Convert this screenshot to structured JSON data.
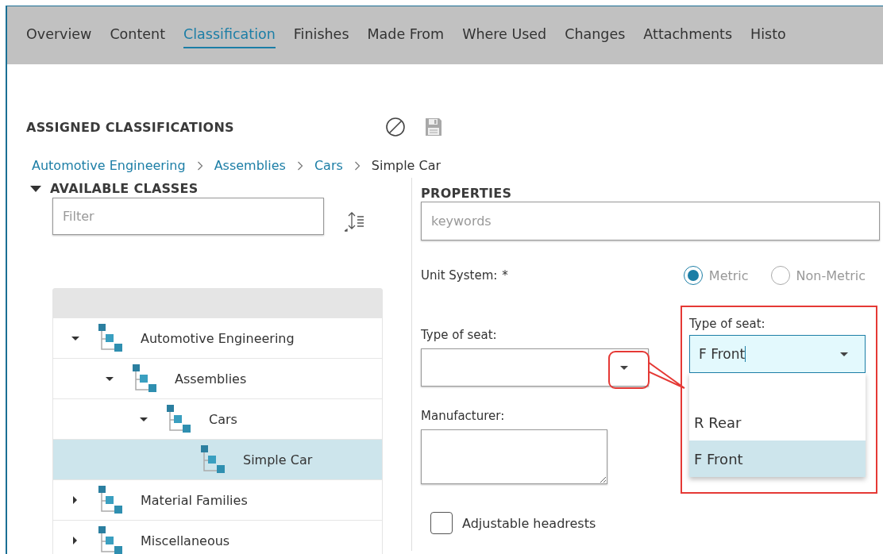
{
  "tabs": [
    {
      "label": "Overview",
      "selected": false
    },
    {
      "label": "Content",
      "selected": false
    },
    {
      "label": "Classification",
      "selected": true
    },
    {
      "label": "Finishes",
      "selected": false
    },
    {
      "label": "Made From",
      "selected": false
    },
    {
      "label": "Where Used",
      "selected": false
    },
    {
      "label": "Changes",
      "selected": false
    },
    {
      "label": "Attachments",
      "selected": false
    },
    {
      "label": "Histo",
      "selected": false
    }
  ],
  "assigned": {
    "title": "ASSIGNED CLASSIFICATIONS"
  },
  "breadcrumbs": [
    {
      "label": "Automotive Engineering",
      "kind": "link"
    },
    {
      "label": "Assemblies",
      "kind": "link"
    },
    {
      "label": "Cars",
      "kind": "link"
    },
    {
      "label": "Simple Car",
      "kind": "current"
    }
  ],
  "available_classes": {
    "title": "AVAILABLE CLASSES",
    "expanded": true,
    "filter": {
      "placeholder": "Filter"
    },
    "tree": [
      {
        "label": "Automotive Engineering",
        "expanded": true,
        "selected": false,
        "children": [
          {
            "label": "Assemblies",
            "expanded": true,
            "selected": false,
            "children": [
              {
                "label": "Cars",
                "expanded": true,
                "selected": false,
                "children": [
                  {
                    "label": "Simple Car",
                    "selected": true
                  }
                ]
              }
            ]
          }
        ]
      },
      {
        "label": "Material Families",
        "expanded": false,
        "selected": false
      },
      {
        "label": "Miscellaneous",
        "expanded": false,
        "selected": false
      }
    ]
  },
  "properties": {
    "title": "PROPERTIES",
    "keywords": {
      "placeholder": "keywords"
    },
    "unit_system": {
      "label": "Unit System:",
      "required_mark": "*",
      "disabled": true,
      "options": [
        {
          "label": "Metric",
          "selected": true
        },
        {
          "label": "Non-Metric",
          "selected": false
        }
      ]
    },
    "type_of_seat": {
      "label": "Type of seat:"
    },
    "manufacturer": {
      "label": "Manufacturer:"
    },
    "adjustable_headrests": {
      "label": "Adjustable headrests",
      "checked": false
    }
  },
  "callout": {
    "label": "Type of seat:",
    "value": "F Front",
    "options": [
      {
        "label": "R Rear",
        "selected": false
      },
      {
        "label": "F Front",
        "selected": true
      }
    ]
  }
}
